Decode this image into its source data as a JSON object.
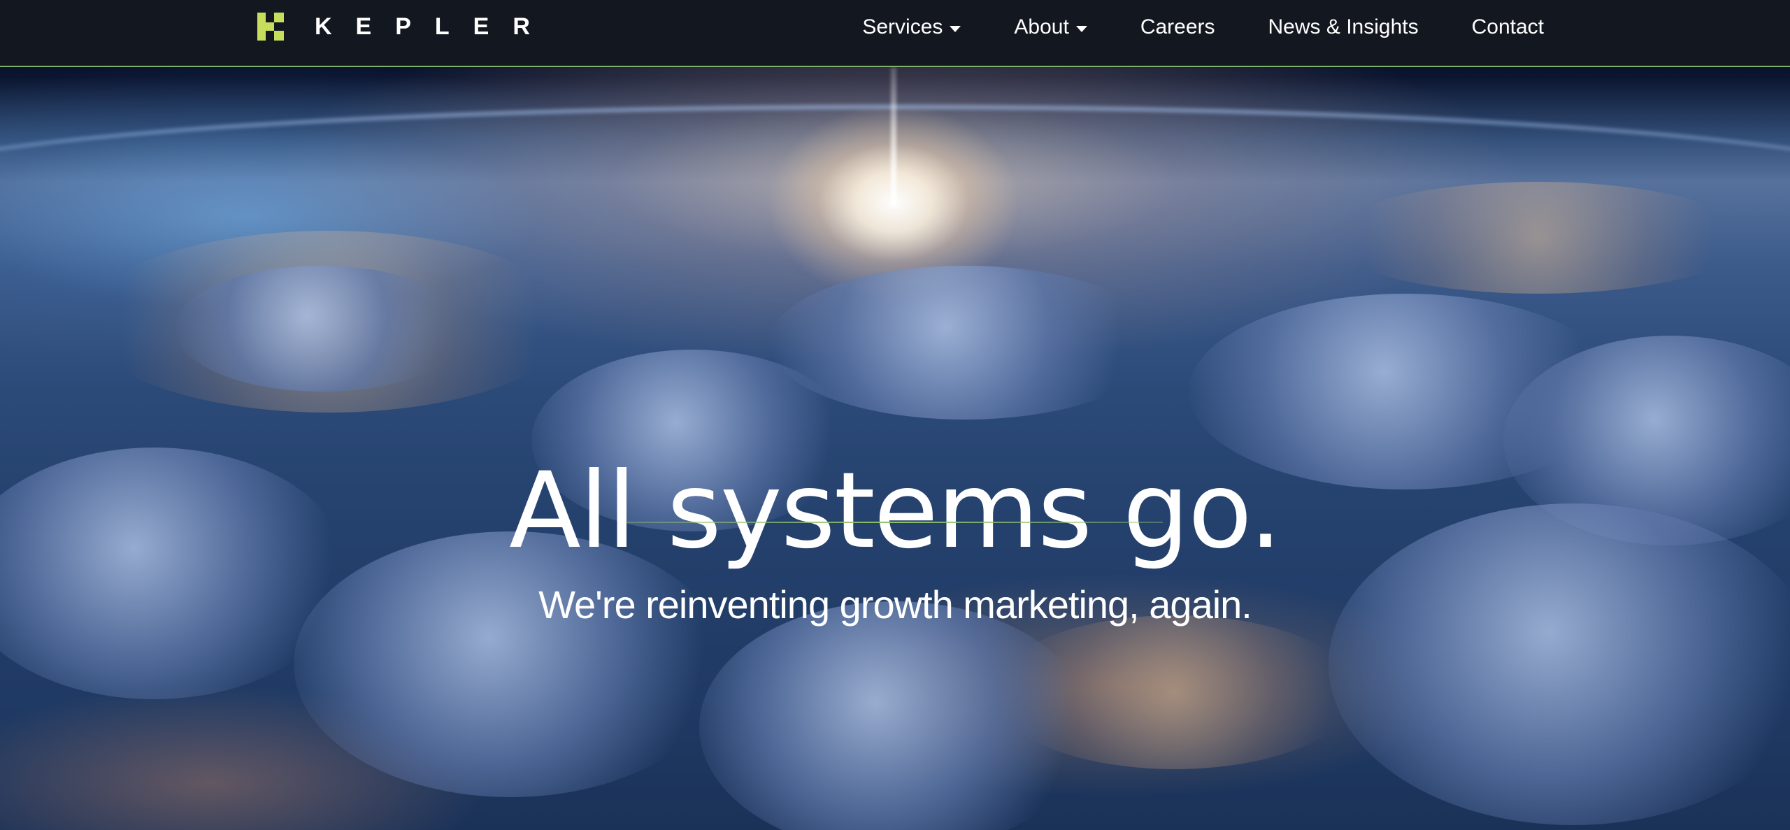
{
  "brand": {
    "name": "KEPLER",
    "mark_color": "#c7dd5c"
  },
  "nav": {
    "items": [
      {
        "label": "Services",
        "has_dropdown": true
      },
      {
        "label": "About",
        "has_dropdown": true
      },
      {
        "label": "Careers",
        "has_dropdown": false
      },
      {
        "label": "News & Insights",
        "has_dropdown": false
      },
      {
        "label": "Contact",
        "has_dropdown": false
      }
    ]
  },
  "hero": {
    "title": "All systems go.",
    "subtitle": "We're reinventing growth marketing, again.",
    "accent_color": "#8fc06a"
  },
  "header": {
    "background": "#131820",
    "border_color": "#7fb26a"
  }
}
